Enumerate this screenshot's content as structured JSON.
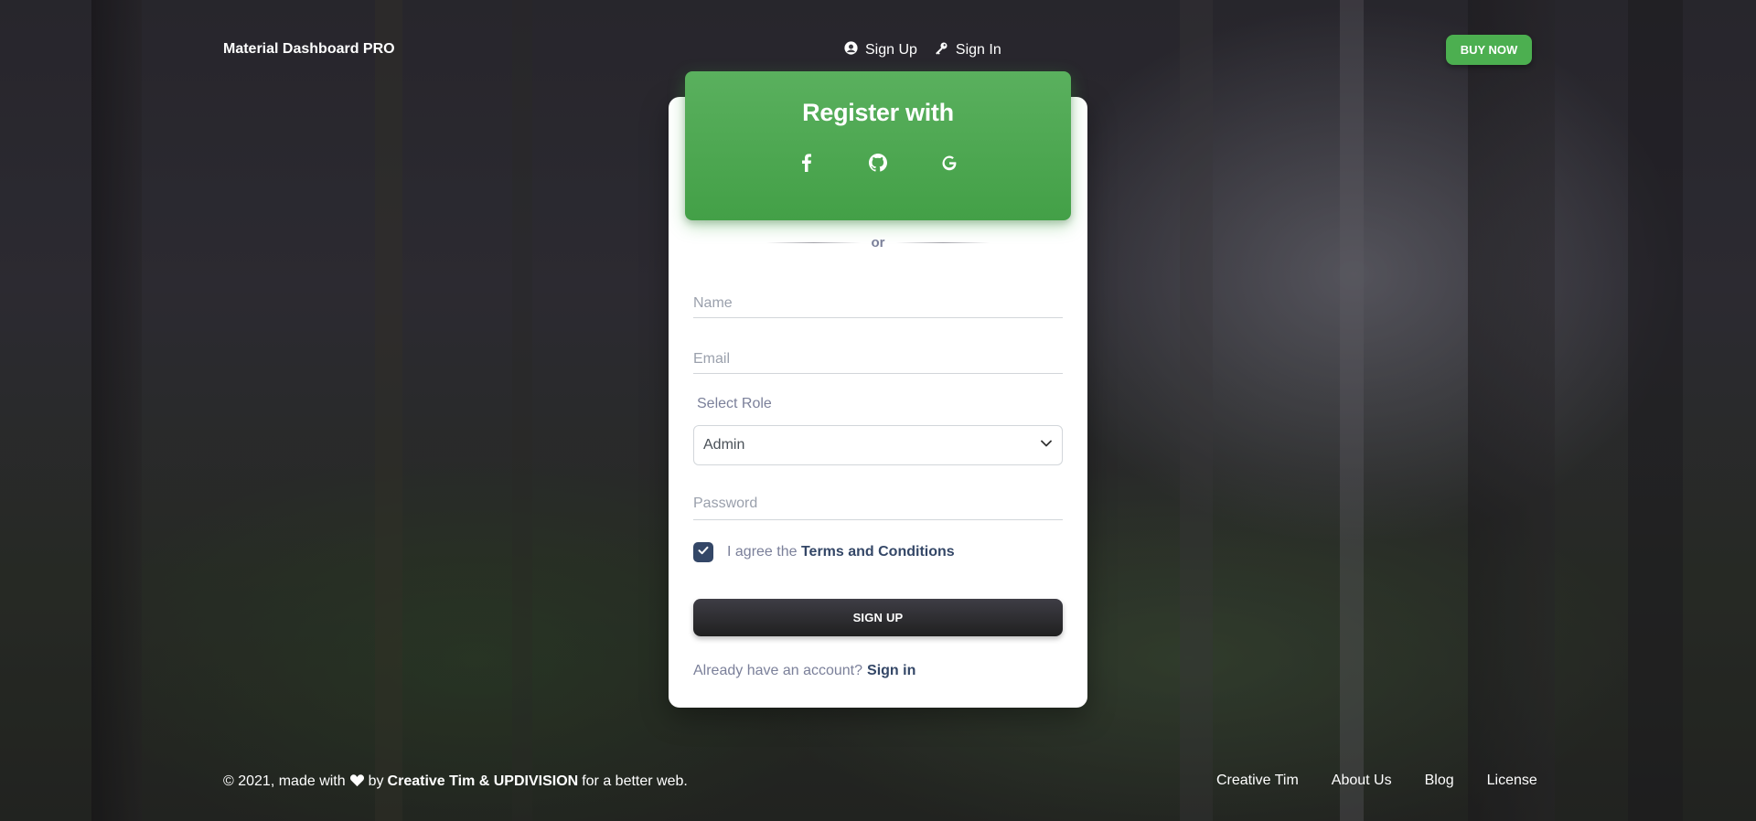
{
  "navbar": {
    "brand": "Material Dashboard PRO",
    "links": [
      {
        "label": "Sign Up",
        "icon": "account-circle-icon"
      },
      {
        "label": "Sign In",
        "icon": "key-icon"
      }
    ],
    "buy_label": "BUY NOW"
  },
  "card": {
    "title": "Register with",
    "socials": [
      "facebook-icon",
      "github-icon",
      "google-icon"
    ],
    "or_label": "or",
    "name_placeholder": "Name",
    "email_placeholder": "Email",
    "role_label": "Select Role",
    "role_value": "Admin",
    "password_placeholder": "Password",
    "agree_text": "I agree the",
    "terms_label": "Terms and Conditions",
    "agree_checked": true,
    "signup_label": "SIGN UP",
    "account_text": "Already have an account?",
    "signin_label": "Sign in"
  },
  "footer": {
    "copyright_prefix": "© 2021, made with",
    "by_text": "by",
    "authors": "Creative Tim & UPDIVISION",
    "suffix": "for a better web.",
    "links": [
      "Creative Tim",
      "About Us",
      "Blog",
      "License"
    ]
  },
  "colors": {
    "accent_green": "#4caf50",
    "dark": "#344767",
    "muted": "#7b809a"
  }
}
